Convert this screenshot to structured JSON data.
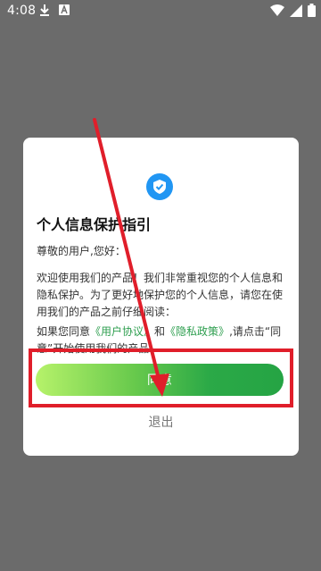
{
  "status_bar": {
    "time": "4:08",
    "icons": [
      "download-icon",
      "a-icon",
      "wifi-icon",
      "signal-icon",
      "battery-icon"
    ]
  },
  "dialog": {
    "icon": "shield-check-icon",
    "title": "个人信息保护指引",
    "greeting": "尊敬的用户,您好：",
    "intro": "欢迎使用我们的产品！我们非常重视您的个人信息和隐私保护。为了更好地保护您的个人信息，请您在使用我们的产品之前仔细阅读：",
    "consent_prefix": "如果您同意",
    "user_agreement_link": "《用户协议》",
    "and": "和",
    "privacy_policy_link": "《隐私政策》",
    "consent_suffix": ",请点击“同意”开始使用我们的产品",
    "agree_label": "同意",
    "exit_label": "退出"
  },
  "colors": {
    "overlay": "#6b6b6b",
    "accent_green": "#2e9e4f",
    "highlight_red": "#e01e2a",
    "shield_blue": "#2196f3"
  }
}
